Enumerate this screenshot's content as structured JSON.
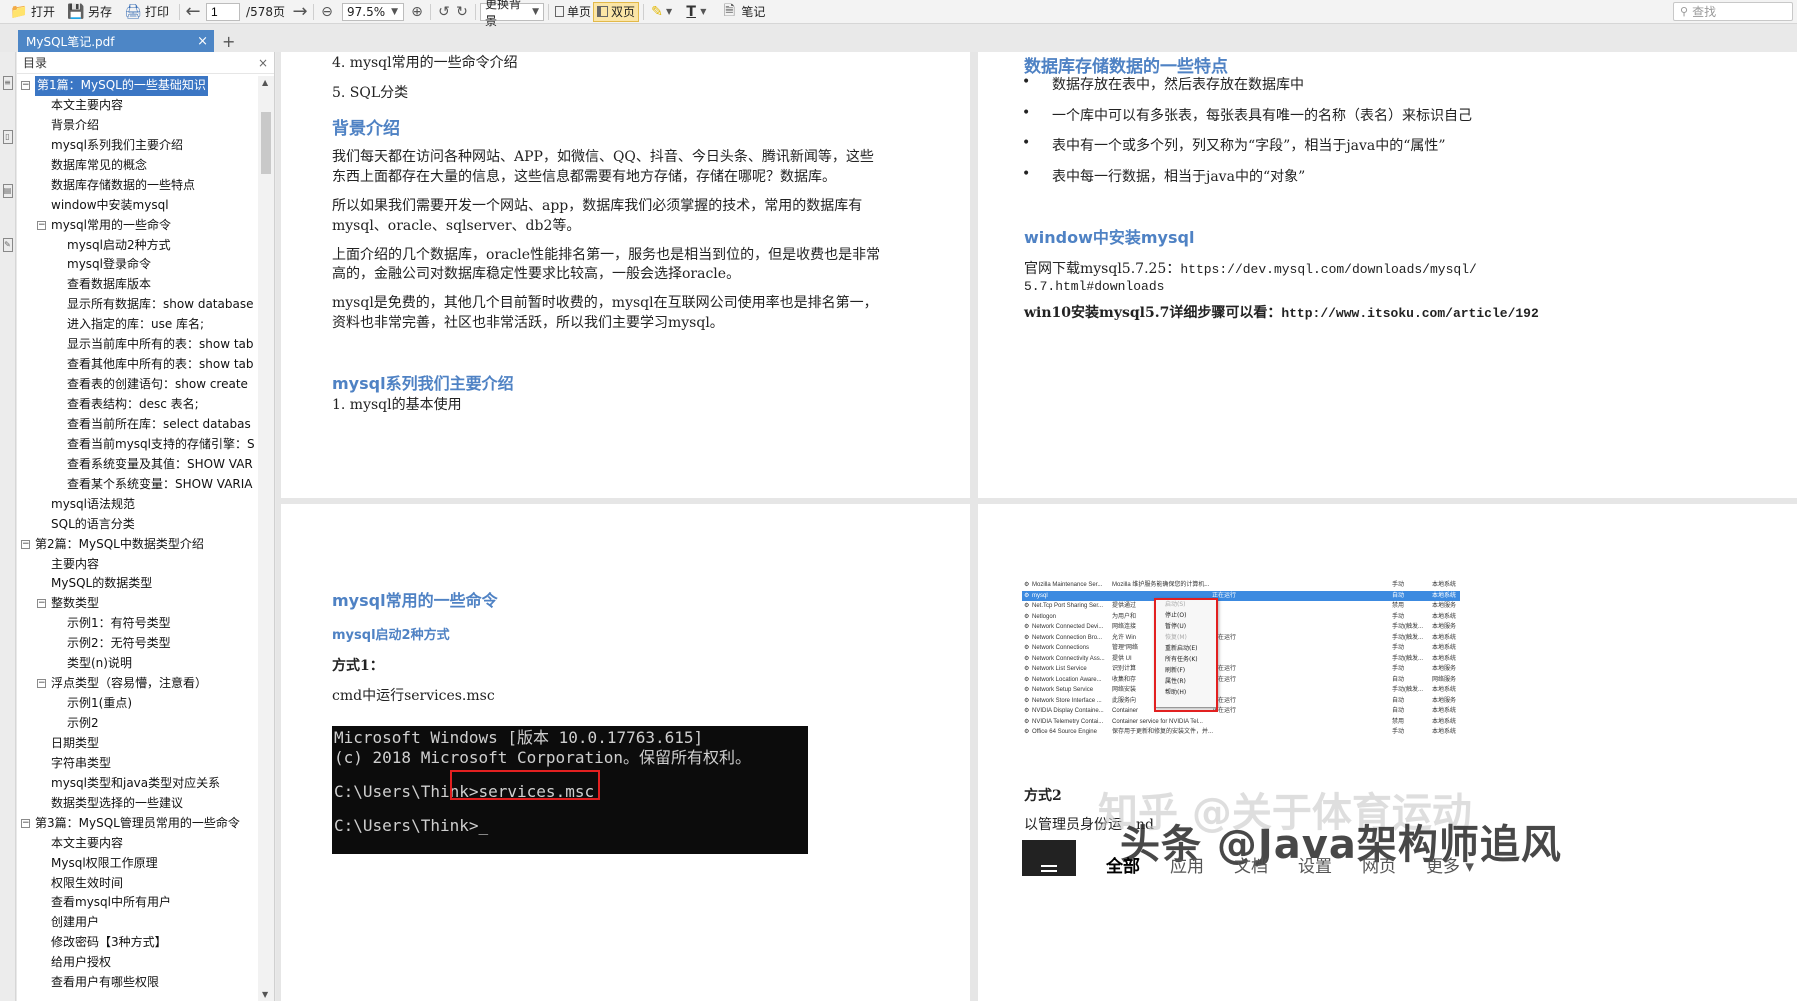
{
  "toolbar": {
    "open": "打开",
    "save_as": "另存",
    "print": "打印",
    "page_input": "1",
    "page_total": "/578页",
    "zoom": "97.5%",
    "background": "更换背景",
    "single": "单页",
    "double": "双页",
    "note": "笔记",
    "search_placeholder": "查找"
  },
  "tab": {
    "title": "MySQL笔记.pdf",
    "close": "×",
    "add": "+"
  },
  "sidebar": {
    "title": "目录",
    "close": "×",
    "items": [
      {
        "level": 0,
        "toggle": "−",
        "label": "第1篇：MySQL的一些基础知识",
        "selected": true
      },
      {
        "level": 1,
        "label": "本文主要内容"
      },
      {
        "level": 1,
        "label": "背景介绍"
      },
      {
        "level": 1,
        "label": "mysql系列我们主要介绍"
      },
      {
        "level": 1,
        "label": "数据库常见的概念"
      },
      {
        "level": 1,
        "label": "数据库存储数据的一些特点"
      },
      {
        "level": 1,
        "label": "window中安装mysql"
      },
      {
        "level": 1,
        "toggle": "−",
        "label": "mysql常用的一些命令"
      },
      {
        "level": 2,
        "label": "mysql启动2种方式"
      },
      {
        "level": 2,
        "label": "mysql登录命令"
      },
      {
        "level": 2,
        "label": "查看数据库版本"
      },
      {
        "level": 2,
        "label": "显示所有数据库：show database"
      },
      {
        "level": 2,
        "label": "进入指定的库：use 库名;"
      },
      {
        "level": 2,
        "label": "显示当前库中所有的表：show tab"
      },
      {
        "level": 2,
        "label": "查看其他库中所有的表：show tab"
      },
      {
        "level": 2,
        "label": "查看表的创建语句：show create"
      },
      {
        "level": 2,
        "label": "查看表结构：desc 表名;"
      },
      {
        "level": 2,
        "label": "查看当前所在库：select databas"
      },
      {
        "level": 2,
        "label": "查看当前mysql支持的存储引擎：S"
      },
      {
        "level": 2,
        "label": "查看系统变量及其值：SHOW VAR"
      },
      {
        "level": 2,
        "label": "查看某个系统变量：SHOW VARIA"
      },
      {
        "level": 1,
        "label": "mysql语法规范"
      },
      {
        "level": 1,
        "label": "SQL的语言分类"
      },
      {
        "level": 0,
        "toggle": "−",
        "label": "第2篇：MySQL中数据类型介绍"
      },
      {
        "level": 1,
        "label": "主要内容"
      },
      {
        "level": 1,
        "label": "MySQL的数据类型"
      },
      {
        "level": 1,
        "toggle": "−",
        "label": "整数类型"
      },
      {
        "level": 2,
        "label": "示例1：有符号类型"
      },
      {
        "level": 2,
        "label": "示例2：无符号类型"
      },
      {
        "level": 2,
        "label": "类型(n)说明"
      },
      {
        "level": 1,
        "toggle": "−",
        "label": "浮点类型（容易懵，注意看）"
      },
      {
        "level": 2,
        "label": "示例1(重点)"
      },
      {
        "level": 2,
        "label": "示例2"
      },
      {
        "level": 1,
        "label": "日期类型"
      },
      {
        "level": 1,
        "label": "字符串类型"
      },
      {
        "level": 1,
        "label": "mysql类型和java类型对应关系"
      },
      {
        "level": 1,
        "label": "数据类型选择的一些建议"
      },
      {
        "level": 0,
        "toggle": "−",
        "label": "第3篇：MySQL管理员常用的一些命令"
      },
      {
        "level": 1,
        "label": "本文主要内容"
      },
      {
        "level": 1,
        "label": "Mysql权限工作原理"
      },
      {
        "level": 1,
        "label": "权限生效时间"
      },
      {
        "level": 1,
        "label": "查看mysql中所有用户"
      },
      {
        "level": 1,
        "label": "创建用户"
      },
      {
        "level": 1,
        "label": "修改密码【3种方式】"
      },
      {
        "level": 1,
        "label": "给用户授权"
      },
      {
        "level": 1,
        "label": "查看用户有哪些权限"
      }
    ]
  },
  "page1": {
    "item4": "4.    mysql常用的一些命令介绍",
    "item5": "5.    SQL分类",
    "h_background": "背景介绍",
    "para1_l1": "我们每天都在访问各种网站、APP，如微信、QQ、抖音、今日头条、腾讯新闻等，这些",
    "para1_l2": "东西上面都存在大量的信息，这些信息都需要有地方存储，存储在哪呢？数据库。",
    "para2_l1": "所以如果我们需要开发一个网站、app，数据库我们必须掌握的技术，常用的数据库有",
    "para2_l2": "mysql、oracle、sqlserver、db2等。",
    "para3_l1": "上面介绍的几个数据库，oracle性能排名第一，服务也是相当到位的，但是收费也是非常",
    "para3_l2": "高的，金融公司对数据库稳定性要求比较高，一般会选择oracle。",
    "para4_l1": "mysql是免费的，其他几个目前暂时收费的，mysql在互联网公司使用率也是排名第一，",
    "para4_l2": "资料也非常完善，社区也非常活跃，所以我们主要学习mysql。",
    "h_series": "mysql系列我们主要介绍",
    "series_item1": "1.    mysql的基本使用"
  },
  "page2": {
    "h_features": "数据库存储数据的一些特点",
    "b1": "数据存放在表中，然后表存放在数据库中",
    "b2": "一个库中可以有多张表，每张表具有唯一的名称（表名）来标识自己",
    "b3": "表中有一个或多个列，列又称为“字段”，相当于java中的“属性”",
    "b4": "表中每一行数据，相当于java中的“对象”",
    "h_install": "window中安装mysql",
    "dl_prefix": "官网下载mysql5.7.25：",
    "dl_url_l1": "https://dev.mysql.com/downloads/mysql/",
    "dl_url_l2": "5.7.html#downloads",
    "win10_prefix": "win10安装mysql5.7详细步骤可以看：",
    "win10_url": "http://www.itsoku.com/article/192"
  },
  "page3": {
    "h_cmds": "mysql常用的一些命令",
    "h_start": "mysql启动2种方式",
    "way1": "方式1：",
    "cmd_run": "cmd中运行services.msc",
    "console_l1": "Microsoft Windows [版本 10.0.17763.615]",
    "console_l2": "(c) 2018 Microsoft Corporation。保留所有权利。",
    "console_prompt1": "C:\\Users\\Think>",
    "console_cmd": "services.msc",
    "console_prompt2": "C:\\Users\\Think>"
  },
  "page4": {
    "services": [
      {
        "name": "Mozilla Maintenance Ser...",
        "desc": "Mozilla 维护服务能确保您的计算机...",
        "status": "",
        "start": "手动",
        "logon": "本地系统"
      },
      {
        "name": "mysql",
        "desc": "",
        "status": "正在运行",
        "start": "自动",
        "logon": "本地系统",
        "selected": true
      },
      {
        "name": "Net.Tcp Port Sharing Ser...",
        "desc": "提供通过",
        "status": "",
        "start": "禁用",
        "logon": "本地服务"
      },
      {
        "name": "Netlogon",
        "desc": "为用户和",
        "status": "",
        "start": "手动",
        "logon": "本地系统"
      },
      {
        "name": "Network Connected Devi...",
        "desc": "网络连接",
        "status": "",
        "start": "手动(触发...",
        "logon": "本地服务"
      },
      {
        "name": "Network Connection Bro...",
        "desc": "允许 Win",
        "status": "正在运行",
        "start": "手动(触发...",
        "logon": "本地系统"
      },
      {
        "name": "Network Connections",
        "desc": "管理“网络",
        "status": "",
        "start": "手动",
        "logon": "本地系统"
      },
      {
        "name": "Network Connectivity Ass...",
        "desc": "提供 UI",
        "status": "",
        "start": "手动(触发...",
        "logon": "本地系统"
      },
      {
        "name": "Network List Service",
        "desc": "识别计算",
        "status": "正在运行",
        "start": "手动",
        "logon": "本地服务"
      },
      {
        "name": "Network Location Aware...",
        "desc": "收集和存",
        "status": "正在运行",
        "start": "自动",
        "logon": "网络服务"
      },
      {
        "name": "Network Setup Service",
        "desc": "网络安装",
        "status": "",
        "start": "手动(触发...",
        "logon": "本地系统"
      },
      {
        "name": "Network Store Interface ...",
        "desc": "此服务向",
        "status": "正在运行",
        "start": "自动",
        "logon": "本地服务"
      },
      {
        "name": "NVIDIA Display Containe...",
        "desc": "Container",
        "status": "正在运行",
        "start": "自动",
        "logon": "本地系统"
      },
      {
        "name": "NVIDIA Telemetry Contai...",
        "desc": "Container service for NVIDIA Tel...",
        "status": "",
        "start": "禁用",
        "logon": "本地系统"
      },
      {
        "name": "Office 64 Source Engine",
        "desc": "保存用于更新和修复的安装文件，并...",
        "status": "",
        "start": "手动",
        "logon": "本地系统"
      }
    ],
    "menu": [
      {
        "label": "启动(S)",
        "disabled": true
      },
      {
        "label": "停止(O)"
      },
      {
        "label": "暂停(U)"
      },
      {
        "label": "恢复(M)",
        "disabled": true
      },
      {
        "label": "重新启动(E)"
      },
      {
        "label": "所有任务(K)"
      },
      {
        "label": "刷新(F)"
      },
      {
        "label": "属性(R)"
      },
      {
        "label": "帮助(H)"
      }
    ],
    "way2": "方式2",
    "admin_prefix": "以管理员身份运",
    "admin_suffix": "nd"
  },
  "watermark": {
    "zhihu": "知乎 @关于体育运动",
    "toutiao": "头条 @Java架构师追风",
    "nav": [
      "全部",
      "应用",
      "文档",
      "设置",
      "网页",
      "更多 ▾"
    ]
  }
}
